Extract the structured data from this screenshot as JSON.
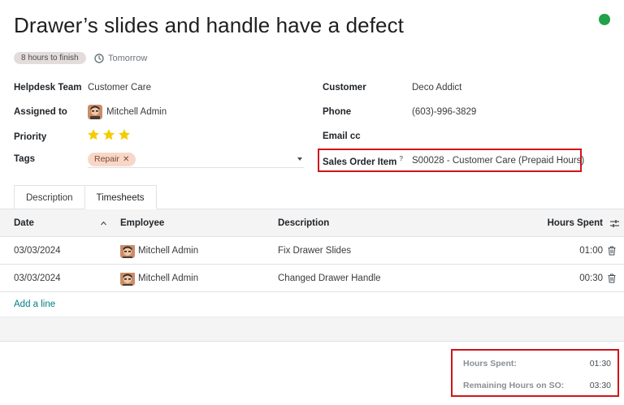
{
  "ticket": {
    "title": "Drawer’s slides and handle have a defect",
    "status_color": "#21a14a",
    "sla_badge": "8 hours to finish",
    "deadline": "Tomorrow"
  },
  "fields": {
    "helpdesk_team_label": "Helpdesk Team",
    "helpdesk_team_value": "Customer Care",
    "assigned_to_label": "Assigned to",
    "assigned_to_value": "Mitchell Admin",
    "priority_label": "Priority",
    "priority_stars": 3,
    "tags_label": "Tags",
    "tags": [
      "Repair"
    ],
    "customer_label": "Customer",
    "customer_value": "Deco Addict",
    "phone_label": "Phone",
    "phone_value": "(603)-996-3829",
    "email_cc_label": "Email cc",
    "email_cc_value": "",
    "sales_order_item_label": "Sales Order Item",
    "sales_order_item_help": "?",
    "sales_order_item_value": "S00028 - Customer Care (Prepaid Hours)"
  },
  "tabs": [
    {
      "label": "Description",
      "active": false
    },
    {
      "label": "Timesheets",
      "active": true
    }
  ],
  "timesheets": {
    "columns": [
      "Date",
      "Employee",
      "Description",
      "Hours Spent"
    ],
    "rows": [
      {
        "date": "03/03/2024",
        "employee": "Mitchell Admin",
        "description": "Fix Drawer Slides",
        "hours": "01:00"
      },
      {
        "date": "03/03/2024",
        "employee": "Mitchell Admin",
        "description": "Changed Drawer Handle",
        "hours": "00:30"
      }
    ],
    "add_line_label": "Add a line"
  },
  "totals": {
    "hours_spent_label": "Hours Spent:",
    "hours_spent_value": "01:30",
    "remaining_label": "Remaining Hours on SO:",
    "remaining_value": "03:30"
  },
  "icons": {
    "deadline": "clock-icon",
    "priority": "star-icon",
    "sort": "chevron-up-icon",
    "optional_columns": "sliders-icon",
    "delete": "trash-icon"
  },
  "colors": {
    "accent": "#017e84",
    "highlight_border": "#d0141b",
    "star": "#f3cc00",
    "tag_bg": "#f8d7c8"
  }
}
